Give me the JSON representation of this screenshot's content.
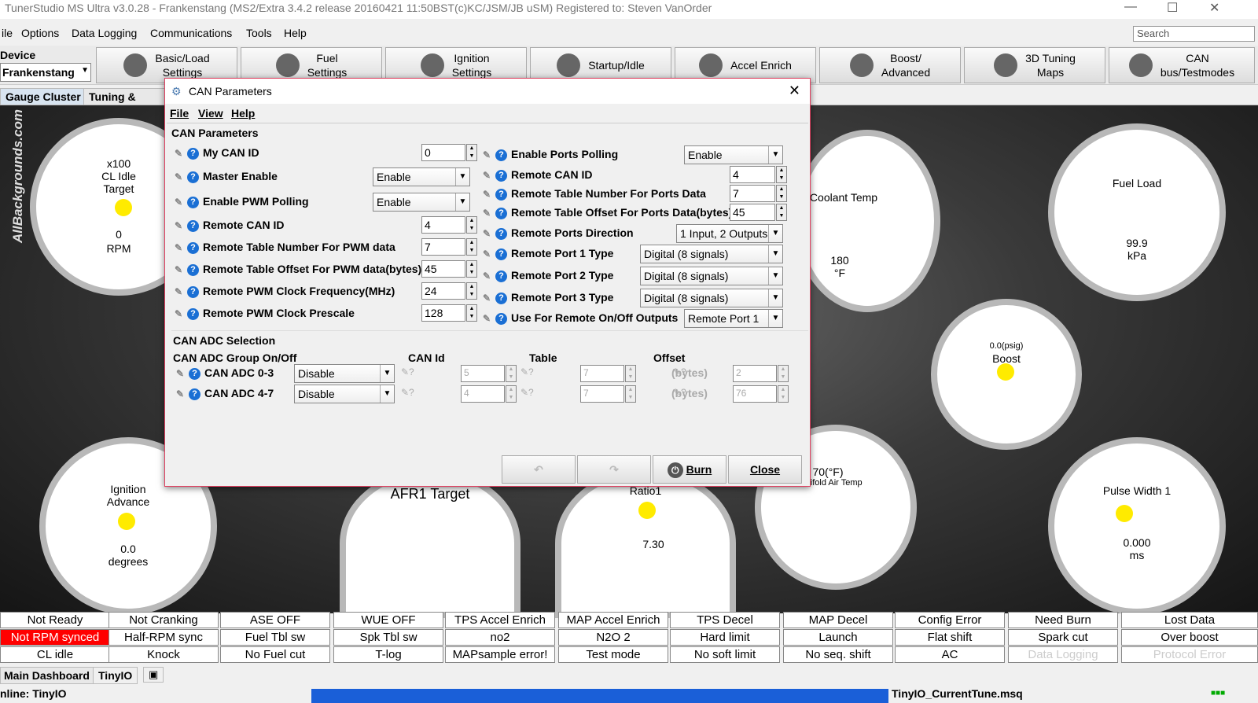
{
  "window": {
    "title": "TunerStudio MS Ultra v3.0.28 - Frankenstang (MS2/Extra 3.4.2 release  20160421 11:50BST(c)KC/JSM/JB   uSM) Registered to: Steven VanOrder"
  },
  "menu": [
    "ile",
    "Options",
    "Data Logging",
    "Communications",
    "Tools",
    "Help"
  ],
  "search": {
    "placeholder": "Search"
  },
  "device": {
    "label": "Device",
    "value": "Frankenstang"
  },
  "toolbar": [
    "Basic/Load\nSettings",
    "Fuel\nSettings",
    "Ignition\nSettings",
    "Startup/Idle",
    "Accel Enrich",
    "Boost/\nAdvanced",
    "3D Tuning\nMaps",
    "CAN\nbus/Testmodes"
  ],
  "tabs": [
    "Gauge Cluster",
    "Tuning & Dyno"
  ],
  "watermark": "AllBackgrounds.com",
  "gauges": [
    {
      "title": "x100\nCL Idle\nTarget",
      "value": "0",
      "unit": "RPM"
    },
    {
      "title": "Coolant Temp",
      "value": "180",
      "unit": "°F"
    },
    {
      "title": "Fuel Load",
      "value": "99.9",
      "unit": "kPa"
    },
    {
      "title": "Boost",
      "value": "0.0(psig)",
      "unit": ""
    },
    {
      "title": "Ignition\nAdvance",
      "value": "0.0",
      "unit": "degrees"
    },
    {
      "title": "AFR1 Target",
      "value": "",
      "unit": ""
    },
    {
      "title": "Ratio1",
      "value": "7.30",
      "unit": ""
    },
    {
      "title": "Manifold Air Temp",
      "value": "70(°F)",
      "unit": ""
    },
    {
      "title": "Pulse Width 1",
      "value": "0.000",
      "unit": "ms"
    }
  ],
  "indicators": [
    [
      "Not Ready",
      "Not Cranking",
      "ASE OFF",
      "WUE OFF",
      "TPS Accel Enrich",
      "MAP Accel Enrich",
      "TPS Decel",
      "MAP Decel",
      "Config Error",
      "Need Burn",
      "Lost Data"
    ],
    [
      "Not RPM synced",
      "Half-RPM sync",
      "Fuel Tbl sw",
      "Spk Tbl sw",
      "no2",
      "N2O 2",
      "Hard limit",
      "Launch",
      "Flat shift",
      "Spark cut",
      "Over boost"
    ],
    [
      "CL idle",
      "Knock",
      "No Fuel cut",
      "T-log",
      "MAPsample error!",
      "Test mode",
      "No soft limit",
      "No seq. shift",
      "AC",
      "Data Logging",
      "Protocol Error"
    ]
  ],
  "indicator_colors": {
    "alert": "#ff0000",
    "normal": "#ffffff"
  },
  "bottom_tabs": [
    "Main Dashboard",
    "TinyIO"
  ],
  "status": {
    "left": "nline: TinyIO",
    "file": "TinyIO_CurrentTune.msq"
  },
  "dialog": {
    "title": "CAN Parameters",
    "menu": [
      "File",
      "View",
      "Help"
    ],
    "section": "CAN Parameters",
    "left": [
      {
        "label": "My CAN ID",
        "value": "0",
        "type": "spin"
      },
      {
        "label": "Master Enable",
        "value": "Enable",
        "type": "select"
      },
      {
        "label": "Enable PWM Polling",
        "value": "Enable",
        "type": "select"
      },
      {
        "label": "Remote CAN ID",
        "value": "4",
        "type": "spin"
      },
      {
        "label": "Remote Table Number For PWM data",
        "value": "7",
        "type": "spin"
      },
      {
        "label": "Remote Table Offset For PWM data(bytes)",
        "value": "45",
        "type": "spin"
      },
      {
        "label": "Remote PWM Clock Frequency(MHz)",
        "value": "24",
        "type": "spin"
      },
      {
        "label": "Remote PWM Clock Prescale",
        "value": "128",
        "type": "spin"
      }
    ],
    "right": [
      {
        "label": "Enable Ports Polling",
        "value": "Enable",
        "type": "select"
      },
      {
        "label": "Remote CAN ID",
        "value": "4",
        "type": "spin"
      },
      {
        "label": "Remote Table Number For Ports Data",
        "value": "7",
        "type": "spin"
      },
      {
        "label": "Remote Table Offset For Ports Data(bytes)",
        "value": "45",
        "type": "spin"
      },
      {
        "label": "Remote Ports Direction",
        "value": "1 Input, 2 Outputs",
        "type": "select"
      },
      {
        "label": "Remote Port 1 Type",
        "value": "Digital (8 signals)",
        "type": "select"
      },
      {
        "label": "Remote Port 2 Type",
        "value": "Digital (8 signals)",
        "type": "select"
      },
      {
        "label": "Remote Port 3 Type",
        "value": "Digital (8 signals)",
        "type": "select"
      },
      {
        "label": "Use For Remote On/Off Outputs",
        "value": "Remote Port 1",
        "type": "select"
      }
    ],
    "adc": {
      "section": "CAN ADC Selection",
      "headers": [
        "CAN ADC Group On/Off",
        "CAN Id",
        "Table",
        "Offset"
      ],
      "rows": [
        {
          "label": "CAN ADC 0-3",
          "value": "Disable",
          "can_id": "5",
          "table": "7",
          "unit": "(bytes)",
          "offset": "2"
        },
        {
          "label": "CAN ADC 4-7",
          "value": "Disable",
          "can_id": "4",
          "table": "7",
          "unit": "(bytes)",
          "offset": "76"
        }
      ]
    },
    "buttons": {
      "burn": "Burn",
      "close": "Close"
    }
  }
}
